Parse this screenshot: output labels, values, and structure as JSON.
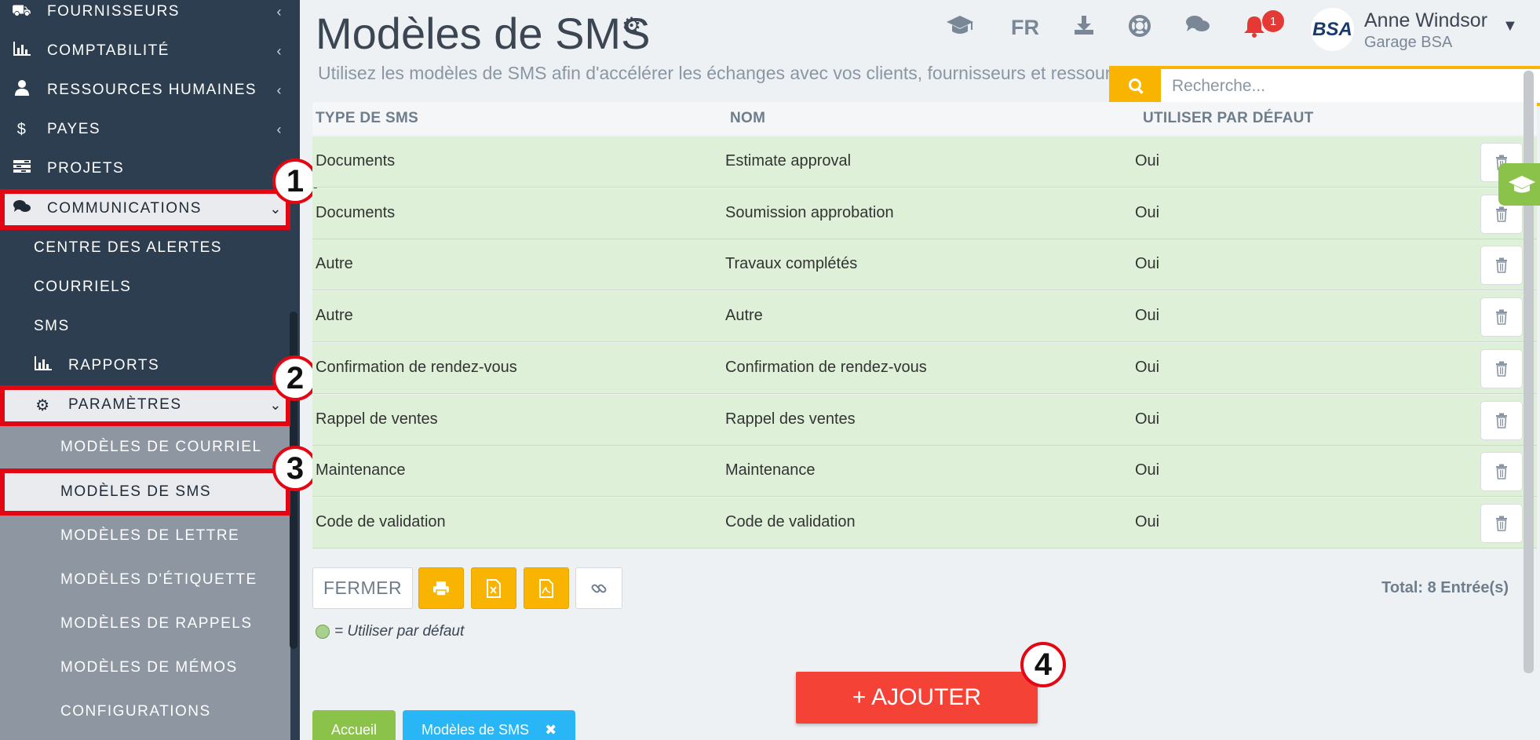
{
  "sidebar": {
    "items": [
      {
        "label": "FOURNISSEURS",
        "icon": "truck-icon"
      },
      {
        "label": "COMPTABILITÉ",
        "icon": "bar-chart-icon"
      },
      {
        "label": "RESSOURCES HUMAINES",
        "icon": "user-icon"
      },
      {
        "label": "PAYES",
        "icon": "dollar-icon"
      },
      {
        "label": "PROJETS",
        "icon": "tasks-icon"
      },
      {
        "label": "COMMUNICATIONS",
        "icon": "chat-icon"
      }
    ],
    "communications_sub": [
      "CENTRE DES ALERTES",
      "COURRIELS",
      "SMS"
    ],
    "rapports": "RAPPORTS",
    "parametres": "PARAMÈTRES",
    "parametres_sub": [
      "MODÈLES DE COURRIEL",
      "MODÈLES DE SMS",
      "MODÈLES DE LETTRE",
      "MODÈLES D'ÉTIQUETTE",
      "MODÈLES DE RAPPELS",
      "MODÈLES DE MÉMOS",
      "CONFIGURATIONS"
    ]
  },
  "annotations": [
    "1",
    "2",
    "3",
    "4"
  ],
  "header": {
    "title": "Modèles de SMS",
    "subtitle": "Utilisez les modèles de SMS afin d'accélérer les échanges avec vos clients, fournisseurs et ressources",
    "lang": "FR",
    "notif_count": "1",
    "user_name": "Anne Windsor",
    "user_company": "Garage BSA",
    "avatar_text": "BSA"
  },
  "search": {
    "placeholder": "Recherche..."
  },
  "table": {
    "columns": [
      "TYPE DE SMS",
      "NOM",
      "UTILISER PAR DÉFAUT"
    ],
    "rows": [
      [
        "Documents",
        "Estimate approval",
        "Oui"
      ],
      [
        "Documents",
        "Soumission approbation",
        "Oui"
      ],
      [
        "Autre",
        "Travaux complétés",
        "Oui"
      ],
      [
        "Autre",
        "Autre",
        "Oui"
      ],
      [
        "Confirmation de rendez-vous",
        "Confirmation de rendez-vous",
        "Oui"
      ],
      [
        "Rappel de ventes",
        "Rappel des ventes",
        "Oui"
      ],
      [
        "Maintenance",
        "Maintenance",
        "Oui"
      ],
      [
        "Code de validation",
        "Code de validation",
        "Oui"
      ]
    ]
  },
  "toolbar": {
    "close_label": "FERMER",
    "total": "Total: 8 Entrée(s)",
    "legend": "= Utiliser par défaut"
  },
  "add_label": "+ AJOUTER",
  "tabs": {
    "home": "Accueil",
    "current": "Modèles de SMS"
  },
  "colors": {
    "sidebar": "#2d3e50",
    "accent": "#f8b400",
    "row_default": "#dff0d8",
    "add_button": "#f44336",
    "annotation": "#e30613"
  }
}
